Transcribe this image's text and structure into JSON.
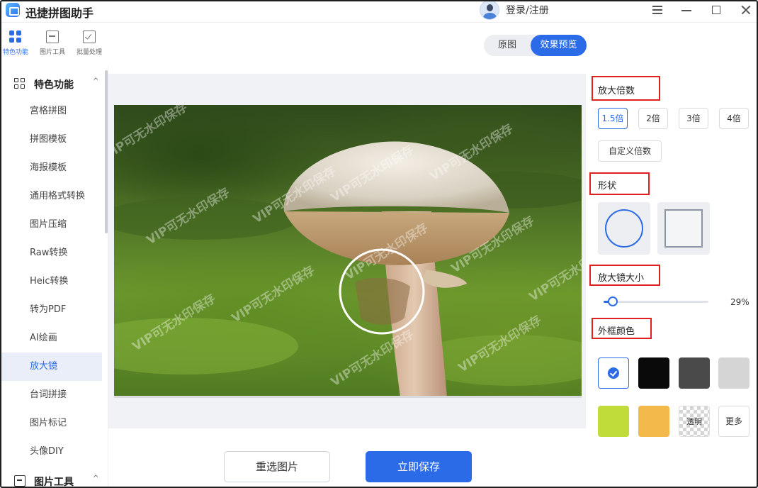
{
  "app": {
    "title": "迅捷拼图助手",
    "login_label": "登录/注册"
  },
  "iconbar": {
    "items": [
      {
        "label": "特色功能"
      },
      {
        "label": "图片工具"
      },
      {
        "label": "批量处理"
      }
    ]
  },
  "sidebar": {
    "section_featured": "特色功能",
    "items": [
      {
        "label": "宫格拼图"
      },
      {
        "label": "拼图模板"
      },
      {
        "label": "海报模板"
      },
      {
        "label": "通用格式转换"
      },
      {
        "label": "图片压缩"
      },
      {
        "label": "Raw转换"
      },
      {
        "label": "Heic转换"
      },
      {
        "label": "转为PDF"
      },
      {
        "label": "AI绘画"
      },
      {
        "label": "放大镜"
      },
      {
        "label": "台词拼接"
      },
      {
        "label": "图片标记"
      },
      {
        "label": "头像DIY"
      }
    ],
    "section_tools": "图片工具"
  },
  "view_tabs": {
    "original": "原图",
    "preview": "效果预览"
  },
  "preview": {
    "watermark_text": "VIP可无水印保存"
  },
  "panel": {
    "zoom_title": "放大倍数",
    "zoom_options": [
      "1.5倍",
      "2倍",
      "3倍",
      "4倍"
    ],
    "zoom_selected": "1.5倍",
    "custom_zoom": "自定义倍数",
    "shape_title": "形状",
    "size_title": "放大镜大小",
    "size_percent": 29,
    "size_label": "29%",
    "border_color_title": "外框颜色",
    "colors": [
      "#ffffff",
      "#0a0a0a",
      "#4a4a4a",
      "#d5d5d5",
      "#bfdc3a",
      "#f3b94a"
    ],
    "transparent_label": "透明",
    "more_label": "更多",
    "accent_color": "#2c6be8",
    "highlight_color": "#e02020"
  },
  "actions": {
    "reselect": "重选图片",
    "save": "立即保存"
  }
}
